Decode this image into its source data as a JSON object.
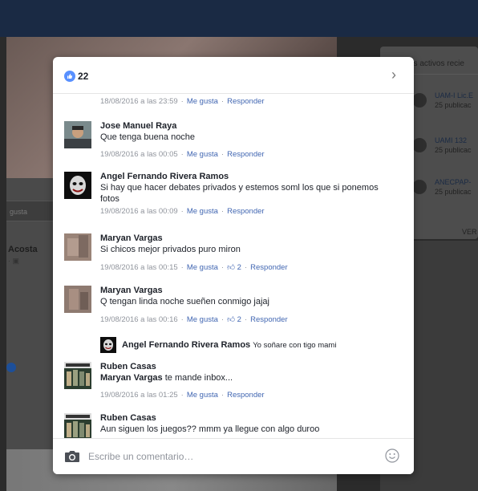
{
  "background": {
    "left_bar_label": "gusta",
    "left_name": "Acosta",
    "left_sub": "· ▣",
    "right_title": "os activos recie",
    "groups": [
      {
        "name": "UAM-I Lic.E",
        "sub": "25 publicac"
      },
      {
        "name": "UAMI 132",
        "sub": "25 publicac"
      },
      {
        "name": "ANECPAP-",
        "sub": "25 publicac"
      }
    ],
    "right_link": "VER"
  },
  "header": {
    "like_count": "22",
    "like_icon": "thumbs-up-icon",
    "next_icon": "chevron-right-icon"
  },
  "comments": [
    {
      "author": "",
      "text": "",
      "timestamp": "18/08/2016 a las 23:59",
      "like_label": "Me gusta",
      "reply_label": "Responder",
      "likes": ""
    },
    {
      "author": "Jose Manuel Raya",
      "text": "Que tenga buena noche",
      "timestamp": "19/08/2016 a las 00:05",
      "like_label": "Me gusta",
      "reply_label": "Responder",
      "likes": ""
    },
    {
      "author": "Angel Fernando Rivera Ramos",
      "text": "Si hay que hacer debates privados y estemos soml los que si ponemos fotos",
      "timestamp": "19/08/2016 a las 00:09",
      "like_label": "Me gusta",
      "reply_label": "Responder",
      "likes": ""
    },
    {
      "author": "Maryan Vargas",
      "text": "Si chicos mejor privados puro miron",
      "timestamp": "19/08/2016 a las 00:15",
      "like_label": "Me gusta",
      "reply_label": "Responder",
      "likes": "2"
    },
    {
      "author": "Maryan Vargas",
      "text": "Q tengan linda noche sueñen conmigo jajaj",
      "timestamp": "19/08/2016 a las 00:16",
      "like_label": "Me gusta",
      "reply_label": "Responder",
      "likes": "2"
    },
    {
      "author": "Ruben Casas",
      "mention": "Maryan Vargas",
      "text": " te mande inbox...",
      "timestamp": "19/08/2016 a las 01:25",
      "like_label": "Me gusta",
      "reply_label": "Responder",
      "likes": ""
    },
    {
      "author": "Ruben Casas",
      "text": "Aun siguen los juegos?? mmm ya llegue con algo duroo",
      "timestamp": "",
      "like_label": "",
      "reply_label": "",
      "likes": ""
    }
  ],
  "reply_preview": {
    "author": "Angel Fernando Rivera Ramos",
    "text": "Yo soñare con tigo mami"
  },
  "footer": {
    "placeholder": "Escribe un comentario…",
    "camera_icon": "camera-icon",
    "emoji_icon": "smiley-icon"
  },
  "colors": {
    "link": "#4267b2",
    "meta": "#90949c",
    "like_badge": "#5890ff",
    "text": "#1d2129"
  }
}
